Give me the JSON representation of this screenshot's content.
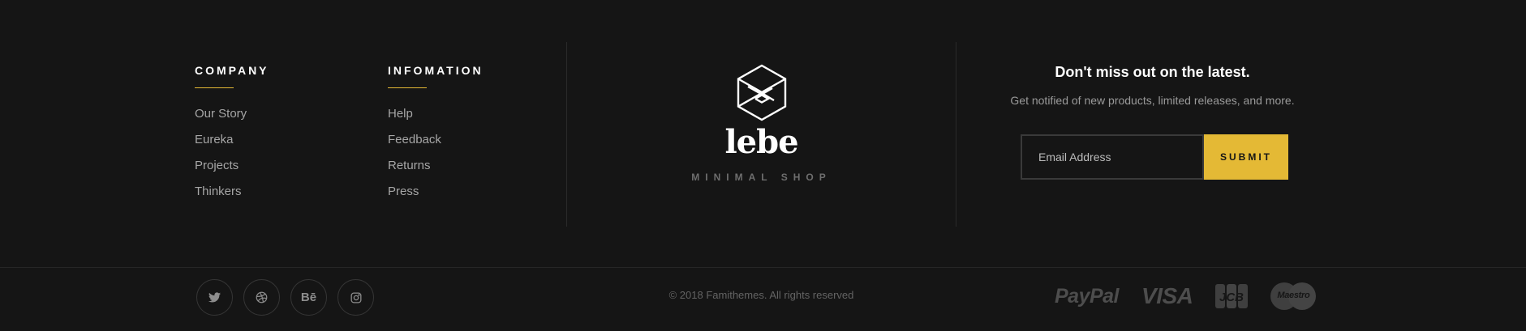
{
  "company": {
    "title": "COMPANY",
    "links": [
      "Our Story",
      "Eureka",
      "Projects",
      "Thinkers"
    ]
  },
  "information": {
    "title": "INFOMATION",
    "links": [
      "Help",
      "Feedback",
      "Returns",
      "Press"
    ]
  },
  "brand": {
    "name": "lebe",
    "tagline": "MINIMAL SHOP",
    "icon": "hexagon-logo-icon"
  },
  "newsletter": {
    "title": "Don't miss out on the latest.",
    "subtitle": "Get notified of new products, limited releases, and more.",
    "placeholder": "Email Address",
    "submit_label": "SUBMIT"
  },
  "social": {
    "icons": [
      "twitter-icon",
      "dribbble-icon",
      "behance-icon",
      "instagram-icon"
    ],
    "behance_label": "Bē"
  },
  "copyright": "© 2018 Famithemes. All rights reserved",
  "payments": {
    "paypal": "PayPal",
    "visa": "VISA",
    "jcb": "JCB",
    "maestro": "Maestro"
  },
  "colors": {
    "background": "#151515",
    "accent": "#e4b935",
    "text_muted": "#a6a6a6",
    "divider": "#2a2a2a"
  }
}
